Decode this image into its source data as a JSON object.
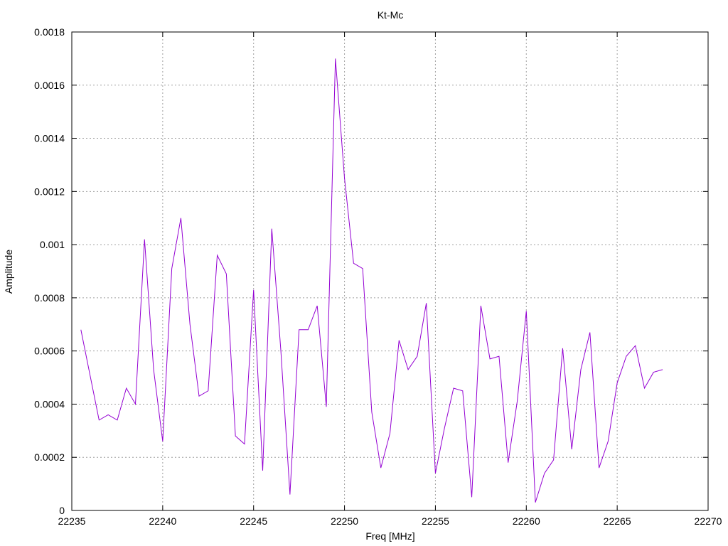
{
  "chart_data": {
    "type": "line",
    "title": "Kt-Mc",
    "xlabel": "Freq [MHz]",
    "ylabel": "Amplitude",
    "xlim": [
      22235,
      22270
    ],
    "ylim": [
      0,
      0.0018
    ],
    "x_ticks": [
      22235,
      22240,
      22245,
      22250,
      22255,
      22260,
      22265,
      22270
    ],
    "y_ticks": [
      0,
      0.0002,
      0.0004,
      0.0006,
      0.0008,
      0.001,
      0.0012,
      0.0014,
      0.0016,
      0.0018
    ],
    "x_tick_labels": [
      "22235",
      "22240",
      "22245",
      "22250",
      "22255",
      "22260",
      "22265",
      "22270"
    ],
    "y_tick_labels": [
      "0",
      "0.0002",
      "0.0004",
      "0.0006",
      "0.0008",
      "0.001",
      "0.0012",
      "0.0014",
      "0.0016",
      "0.0018"
    ],
    "grid": true,
    "series": [
      {
        "color": "#9400d3",
        "x": [
          22235.5,
          22236.0,
          22236.5,
          22237.0,
          22237.5,
          22238.0,
          22238.5,
          22239.0,
          22239.5,
          22240.0,
          22240.5,
          22241.0,
          22241.5,
          22242.0,
          22242.5,
          22243.0,
          22243.5,
          22244.0,
          22244.5,
          22245.0,
          22245.5,
          22246.0,
          22246.5,
          22247.0,
          22247.5,
          22248.0,
          22248.5,
          22249.0,
          22249.5,
          22250.0,
          22250.5,
          22251.0,
          22251.5,
          22252.0,
          22252.5,
          22253.0,
          22253.5,
          22254.0,
          22254.5,
          22255.0,
          22255.5,
          22256.0,
          22256.5,
          22257.0,
          22257.5,
          22258.0,
          22258.5,
          22259.0,
          22259.5,
          22260.0,
          22260.5,
          22261.0,
          22261.5,
          22262.0,
          22262.5,
          22263.0,
          22263.5,
          22264.0,
          22264.5,
          22265.0,
          22265.5,
          22266.0,
          22266.5,
          22267.0,
          22267.5
        ],
        "y": [
          0.00068,
          0.00051,
          0.00034,
          0.00036,
          0.00034,
          0.00046,
          0.0004,
          0.00102,
          0.00053,
          0.00026,
          0.00091,
          0.0011,
          0.0007,
          0.00043,
          0.00045,
          0.00096,
          0.00089,
          0.00028,
          0.00025,
          0.00083,
          0.00015,
          0.00106,
          0.0006,
          6e-05,
          0.00068,
          0.00068,
          0.00077,
          0.00039,
          0.0017,
          0.00125,
          0.00093,
          0.00091,
          0.00037,
          0.00016,
          0.00029,
          0.00064,
          0.00053,
          0.00058,
          0.00078,
          0.00014,
          0.00031,
          0.00046,
          0.00045,
          5e-05,
          0.00077,
          0.00057,
          0.00058,
          0.00018,
          0.00041,
          0.00075,
          3e-05,
          0.00014,
          0.00019,
          0.00061,
          0.00023,
          0.00053,
          0.00067,
          0.00016,
          0.00026,
          0.00048,
          0.00058,
          0.00062,
          0.00046,
          0.00052,
          0.00053
        ]
      }
    ]
  }
}
